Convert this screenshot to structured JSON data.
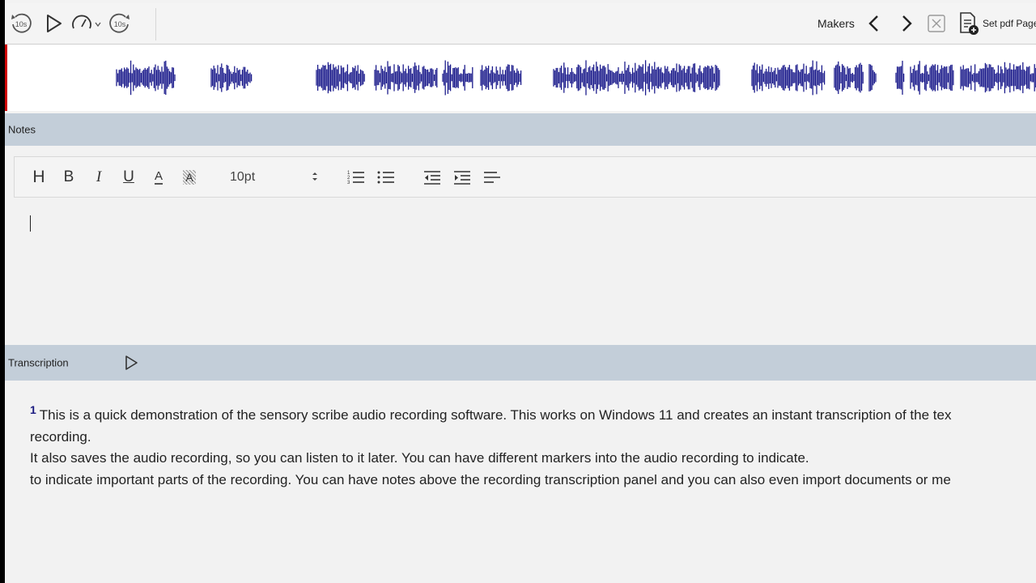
{
  "toolbar": {
    "rewind_label": "10s",
    "forward_label": "10s",
    "makers_label": "Makers",
    "set_pdf_label": "Set pdf Page",
    "icons": [
      "rewind-10s-icon",
      "play-icon",
      "playback-speed-icon",
      "forward-10s-icon",
      "chevron-left-icon",
      "chevron-right-icon",
      "close-x-icon",
      "add-pdf-page-icon"
    ]
  },
  "notes": {
    "header": "Notes",
    "toolbar": {
      "heading": "H",
      "bold": "B",
      "italic": "I",
      "underline": "U",
      "font_color": "A",
      "highlight": "A",
      "font_size": "10pt"
    }
  },
  "transcription": {
    "header": "Transcription",
    "segment_number": "1",
    "lines": [
      "This is a quick demonstration of the sensory scribe audio recording software. This works on Windows 11 and creates an instant transcription of the tex",
      "recording.",
      "It also saves the audio recording, so you can listen to it later. You can have different markers into the audio recording to indicate.",
      "to indicate important parts of the recording. You can have notes above the recording transcription panel and you can also even import documents or me"
    ]
  },
  "colors": {
    "waveform": "#1c1c8c",
    "header_bg": "#c3ced9",
    "playhead": "#d00000"
  }
}
